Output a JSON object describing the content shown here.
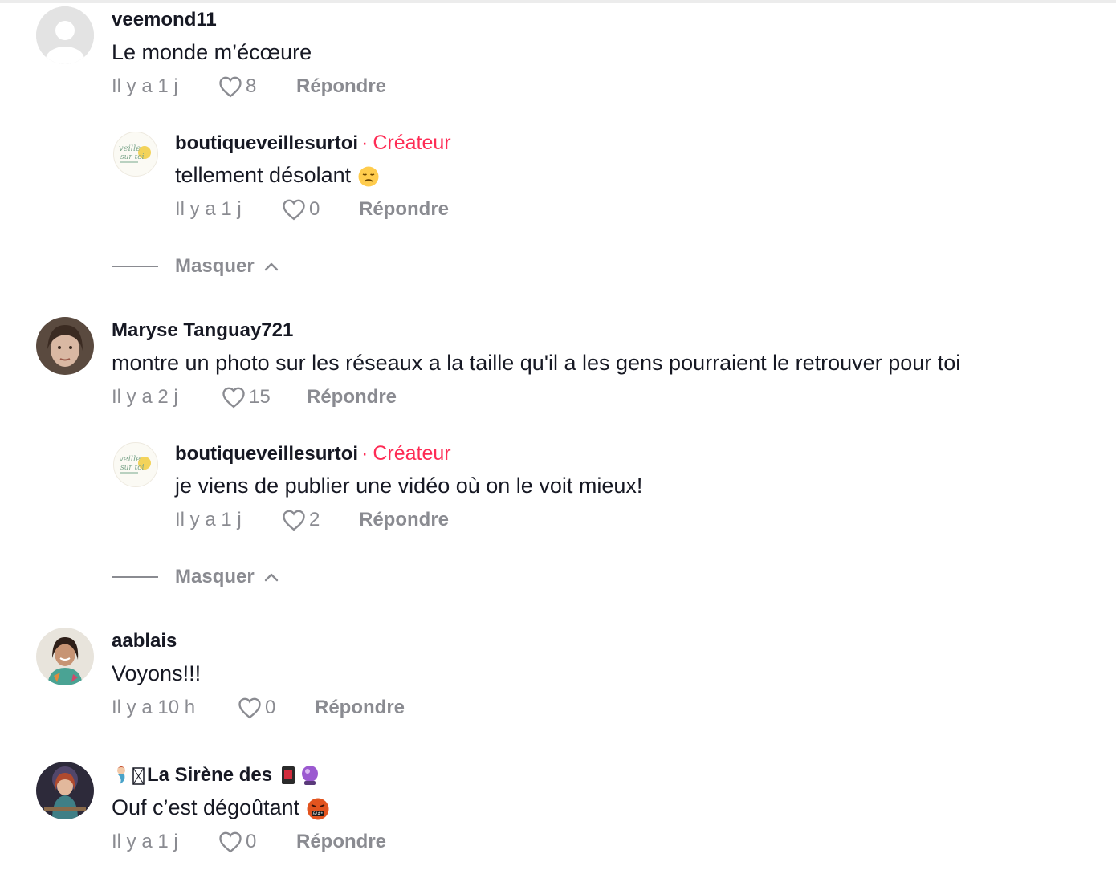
{
  "comments": [
    {
      "username": "veemond11",
      "text": "Le monde m’écœure",
      "time": "Il y a 1 j",
      "likes": "8",
      "reply_label": "Répondre",
      "avatar": "default-avatar",
      "replies": [
        {
          "username": "boutiqueveillesurtoi",
          "creator_dot": "·",
          "creator_label": "Créateur",
          "text": "tellement désolant",
          "emoji": "disappointed-face",
          "time": "Il y a 1 j",
          "likes": "0",
          "reply_label": "Répondre"
        }
      ],
      "hide_label": "Masquer"
    },
    {
      "username": "Maryse Tanguay721",
      "text": "montre un photo sur les réseaux a la taille qu'il a les gens pourraient le retrouver pour toi",
      "time": "Il y a 2 j",
      "likes": "15",
      "reply_label": "Répondre",
      "avatar": "woman-photo-avatar",
      "replies": [
        {
          "username": "boutiqueveillesurtoi",
          "creator_dot": "·",
          "creator_label": "Créateur",
          "text": "je viens de publier une vidéo où on le voit mieux!",
          "time": "Il y a 1 j",
          "likes": "2",
          "reply_label": "Répondre"
        }
      ],
      "hide_label": "Masquer"
    },
    {
      "username": "aablais",
      "text": "Voyons!!!",
      "time": "Il y a 10 h",
      "likes": "0",
      "reply_label": "Répondre",
      "avatar": "woman-smiling-avatar"
    },
    {
      "username": "La Sirène des",
      "username_prefix_emoji": "mermaid-emoji",
      "username_suffix_emoji": [
        "card-emoji",
        "crystal-ball-emoji"
      ],
      "text": "Ouf c’est dégoûtant",
      "emoji": "cursing-face",
      "time": "Il y a 1 j",
      "likes": "0",
      "reply_label": "Répondre",
      "avatar": "mermaid-art-avatar"
    }
  ],
  "colors": {
    "creator": "#fe2c55",
    "meta": "#8a8b91",
    "text": "#161823"
  }
}
